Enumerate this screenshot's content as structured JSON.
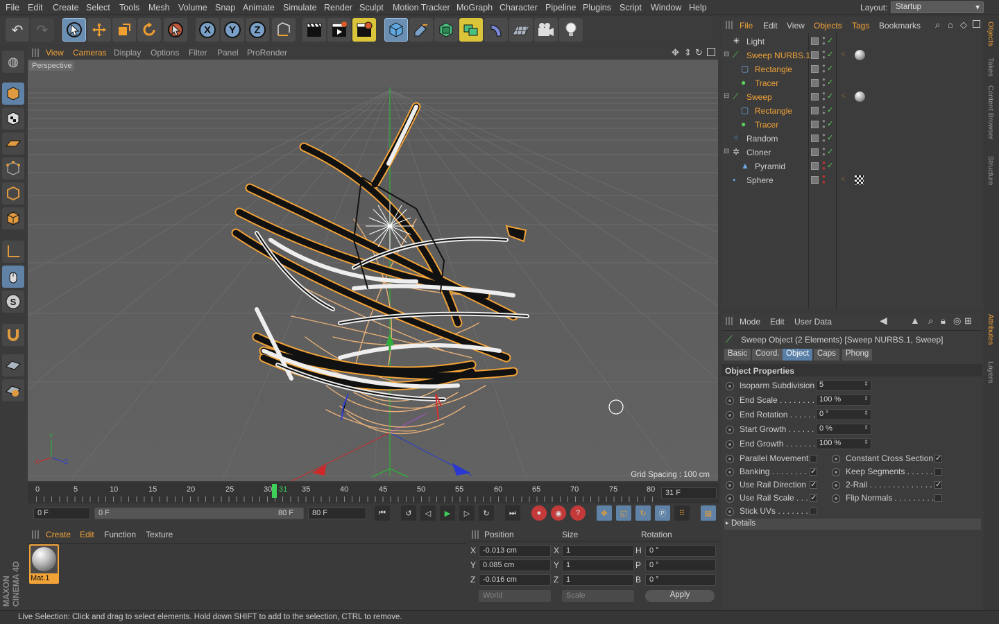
{
  "menubar": {
    "items": [
      {
        "label": "File",
        "hl": false
      },
      {
        "label": "Edit",
        "hl": false
      },
      {
        "label": "Create",
        "hl": false
      },
      {
        "label": "Select",
        "hl": false
      },
      {
        "label": "Tools",
        "hl": false
      },
      {
        "label": "Mesh",
        "hl": false
      },
      {
        "label": "Volume",
        "hl": false
      },
      {
        "label": "Snap",
        "hl": false
      },
      {
        "label": "Animate",
        "hl": false
      },
      {
        "label": "Simulate",
        "hl": false
      },
      {
        "label": "Render",
        "hl": false
      },
      {
        "label": "Sculpt",
        "hl": false
      },
      {
        "label": "Motion Tracker",
        "hl": false
      },
      {
        "label": "MoGraph",
        "hl": false
      },
      {
        "label": "Character",
        "hl": false
      },
      {
        "label": "Pipeline",
        "hl": false
      },
      {
        "label": "Plugins",
        "hl": false
      },
      {
        "label": "Script",
        "hl": false
      },
      {
        "label": "Window",
        "hl": false
      },
      {
        "label": "Help",
        "hl": false
      }
    ],
    "layout_label": "Layout:",
    "layout_value": "Startup"
  },
  "viewport_menu": {
    "items": [
      "View",
      "Cameras",
      "Display",
      "Options",
      "Filter",
      "Panel",
      "ProRender"
    ],
    "camera_label": "Perspective",
    "grid_spacing": "Grid Spacing : 100 cm"
  },
  "timeline": {
    "ticks": [
      "0",
      "5",
      "10",
      "15",
      "20",
      "25",
      "30",
      "35",
      "40",
      "45",
      "50",
      "55",
      "60",
      "65",
      "70",
      "75",
      "80"
    ],
    "current_frame_marker": "31",
    "current_frame_field": "31 F"
  },
  "playbar": {
    "start_field": "0 F",
    "range_start": "0 F",
    "range_end": "80 F",
    "end_field": "80 F"
  },
  "material_panel": {
    "menu": [
      "Create",
      "Edit",
      "Function",
      "Texture"
    ],
    "materials": [
      {
        "name": "Mat.1"
      }
    ],
    "brand": "MAXON CINEMA 4D"
  },
  "coord_panel": {
    "headers": [
      "Position",
      "Size",
      "Rotation"
    ],
    "rows": [
      {
        "axis": "X",
        "pos": "-0.013 cm",
        "size_axis": "X",
        "size": "1",
        "rot_axis": "H",
        "rot": "0 °"
      },
      {
        "axis": "Y",
        "pos": "0.085 cm",
        "size_axis": "Y",
        "size": "1",
        "rot_axis": "P",
        "rot": "0 °"
      },
      {
        "axis": "Z",
        "pos": "-0.016 cm",
        "size_axis": "Z",
        "size": "1",
        "rot_axis": "B",
        "rot": "0 °"
      }
    ],
    "space": "World",
    "mode": "Scale",
    "apply_label": "Apply"
  },
  "object_manager": {
    "menu": [
      {
        "label": "File",
        "hl": true
      },
      {
        "label": "Edit",
        "hl": false
      },
      {
        "label": "View",
        "hl": false
      },
      {
        "label": "Objects",
        "hl": true
      },
      {
        "label": "Tags",
        "hl": false
      },
      {
        "label": "Bookmarks",
        "hl": false
      }
    ],
    "objects": [
      {
        "name": "Light",
        "indent": 0,
        "color": "#cfcfcf",
        "icon": "light-icon",
        "tags": []
      },
      {
        "name": "Sweep NURBS.1",
        "indent": 0,
        "color": "#f2a338",
        "icon": "sweep-icon",
        "tags": [
          "phong",
          "material"
        ]
      },
      {
        "name": "Rectangle",
        "indent": 1,
        "color": "#f2a338",
        "icon": "rectangle-spline-icon",
        "tags": []
      },
      {
        "name": "Tracer",
        "indent": 1,
        "color": "#f2a338",
        "icon": "tracer-icon",
        "tags": []
      },
      {
        "name": "Sweep",
        "indent": 0,
        "color": "#f2a338",
        "icon": "sweep-icon",
        "tags": [
          "phong",
          "material"
        ]
      },
      {
        "name": "Rectangle",
        "indent": 1,
        "color": "#f2a338",
        "icon": "rectangle-spline-icon",
        "tags": []
      },
      {
        "name": "Tracer",
        "indent": 1,
        "color": "#f2a338",
        "icon": "tracer-icon",
        "tags": []
      },
      {
        "name": "Random",
        "indent": 0,
        "color": "#cfcfcf",
        "icon": "random-effector-icon",
        "tags": []
      },
      {
        "name": "Cloner",
        "indent": 0,
        "color": "#cfcfcf",
        "icon": "cloner-icon",
        "tags": []
      },
      {
        "name": "Pyramid",
        "indent": 1,
        "color": "#cfcfcf",
        "icon": "pyramid-icon",
        "tags": []
      },
      {
        "name": "Sphere",
        "indent": 0,
        "color": "#cfcfcf",
        "icon": "sphere-icon",
        "tags": [
          "phong",
          "checker"
        ]
      }
    ]
  },
  "attributes": {
    "menu": [
      "Mode",
      "Edit",
      "User Data"
    ],
    "title": "Sweep Object (2 Elements) [Sweep NURBS.1, Sweep]",
    "tabs": [
      {
        "label": "Basic",
        "selected": false
      },
      {
        "label": "Coord.",
        "selected": false
      },
      {
        "label": "Object",
        "selected": true
      },
      {
        "label": "Caps",
        "selected": false
      },
      {
        "label": "Phong",
        "selected": false
      }
    ],
    "section": "Object Properties",
    "fields": [
      {
        "label": "Isoparm Subdivision",
        "value": "5"
      },
      {
        "label": "End Scale . . . . . . . . .",
        "value": "100 %"
      },
      {
        "label": "End Rotation . . . . . .",
        "value": "0 °"
      },
      {
        "label": "Start Growth . . . . . .",
        "value": "0 %"
      },
      {
        "label": "End Growth . . . . . . .",
        "value": "100 %"
      }
    ],
    "checks_left": [
      {
        "label": "Parallel Movement",
        "checked": false
      },
      {
        "label": "Banking . . . . . . . . .",
        "checked": true
      },
      {
        "label": "Use Rail Direction",
        "checked": true
      },
      {
        "label": "Use Rail Scale . . .",
        "checked": true
      },
      {
        "label": "Stick UVs . . . . . . .",
        "checked": false
      }
    ],
    "checks_right": [
      {
        "label": "Constant Cross Section",
        "checked": true
      },
      {
        "label": "Keep Segments . . . . . . .",
        "checked": false
      },
      {
        "label": "2-Rail . . . . . . . . . . . . . . .",
        "checked": true
      },
      {
        "label": "Flip Normals . . . . . . . . .",
        "checked": false
      }
    ],
    "details": "Details"
  },
  "side_tabs": [
    {
      "label": "Objects",
      "hl": true
    },
    {
      "label": "Takes",
      "hl": false
    },
    {
      "label": "Content Browser",
      "hl": false
    },
    {
      "label": "Structure",
      "hl": false
    },
    {
      "label": "Attributes",
      "hl": true
    },
    {
      "label": "Layers",
      "hl": false
    }
  ],
  "status": "Live Selection: Click and drag to select elements. Hold down SHIFT to add to the selection, CTRL to remove."
}
